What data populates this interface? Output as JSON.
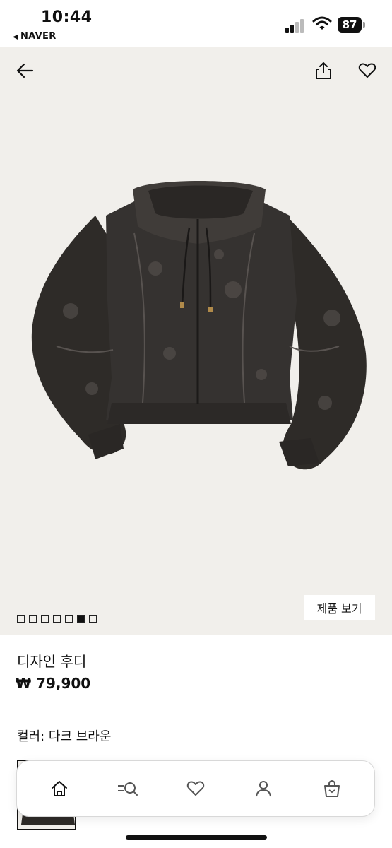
{
  "status_bar": {
    "time": "10:44",
    "back_app": "NAVER",
    "battery": "87"
  },
  "product": {
    "pager": {
      "total": 7,
      "active_index": 5
    },
    "view_product_label": "제품 보기",
    "title": "디자인 후디",
    "price": "₩ 79,900",
    "color_label": "컬러: 다크 브라운"
  },
  "icons": {
    "back": "arrow-left-icon",
    "share": "share-icon",
    "wishlist": "heart-icon"
  },
  "bottom_nav": [
    {
      "icon": "home-icon"
    },
    {
      "icon": "category-search-icon"
    },
    {
      "icon": "heart-icon"
    },
    {
      "icon": "user-icon"
    },
    {
      "icon": "shopping-bag-icon"
    }
  ]
}
